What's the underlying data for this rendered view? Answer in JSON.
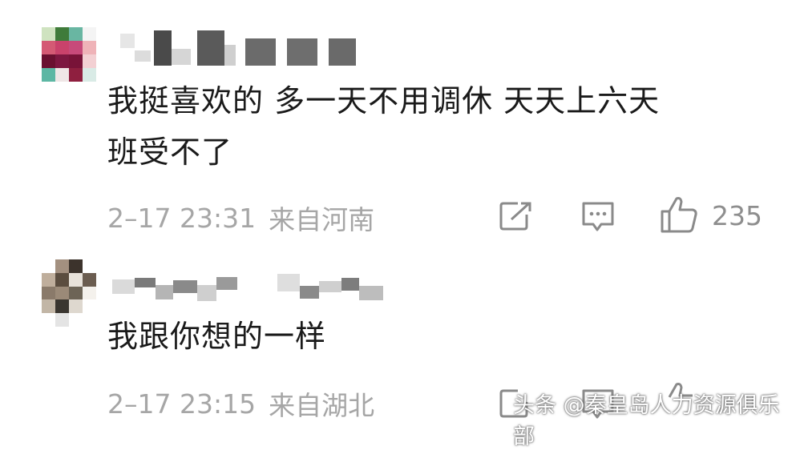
{
  "comments": [
    {
      "text_line1": "我挺喜欢的 多一天不用调休 天天上六天",
      "text_line2": "班受不了",
      "date": "2–17 23:31",
      "location": "来自河南",
      "likes": "235"
    },
    {
      "text_line1": "我跟你想的一样",
      "date": "2–17 23:15",
      "location": "来自湖北"
    }
  ],
  "icons": {
    "share": "share-icon",
    "reply": "comment-icon",
    "like": "thumbs-up-icon"
  },
  "watermark": "头条 @秦皇岛人力资源俱乐部"
}
